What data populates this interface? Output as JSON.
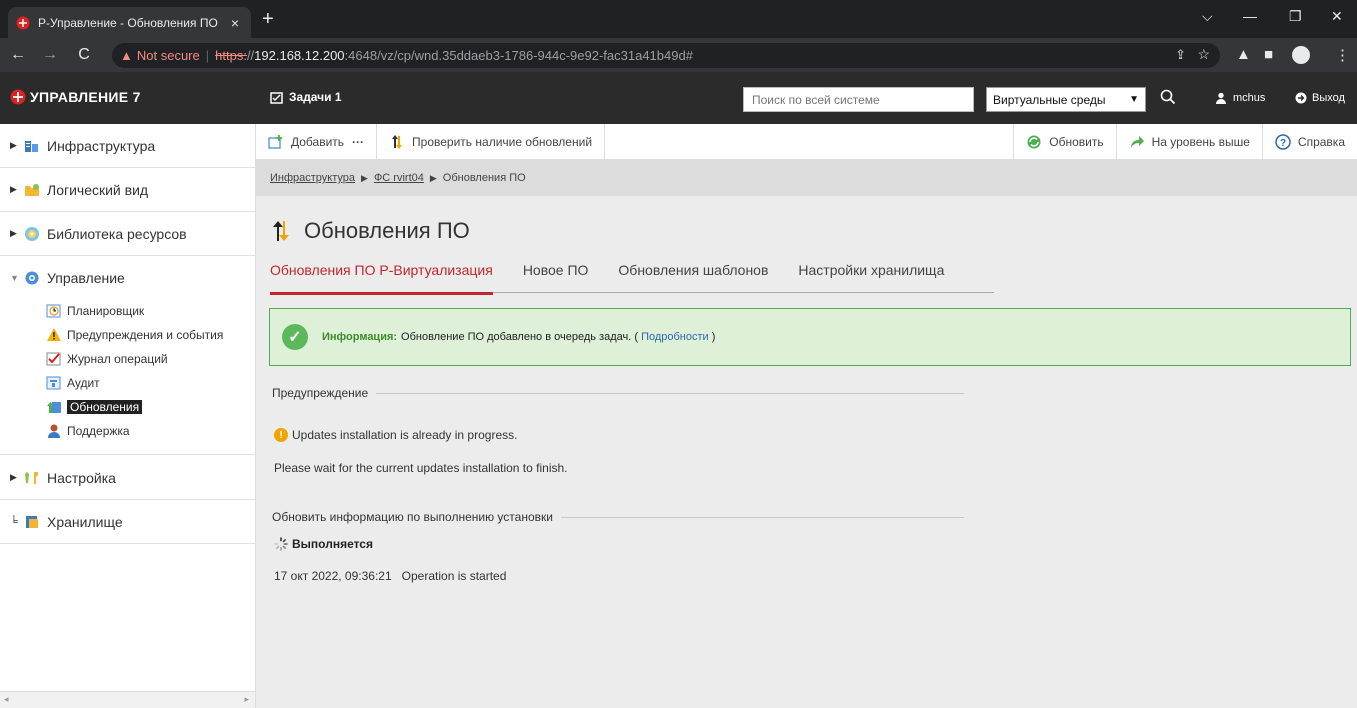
{
  "browser": {
    "tab_title": "Р-Управление - Обновления ПО",
    "tab_close": "×",
    "new_tab": "+",
    "not_secure": "Not secure",
    "url_proto": "https:",
    "url_slashes": "//",
    "url_host": "192.168.12.200",
    "url_path": ":4648/vz/cp/wnd.35ddaeb3-1786-944c-9e92-fac31a41b49d#"
  },
  "header": {
    "logo": "УПРАВЛЕНИЕ 7",
    "tasks_label": "Задачи 1",
    "search_placeholder": "Поиск по всей системе",
    "env_select": "Виртуальные среды",
    "user": "mchus",
    "logout": "Выход"
  },
  "sidebar": {
    "infra": "Инфраструктура",
    "logical": "Логический вид",
    "library": "Библиотека ресурсов",
    "management": "Управление",
    "sub": {
      "scheduler": "Планировщик",
      "alerts": "Предупреждения и события",
      "journal": "Журнал операций",
      "audit": "Аудит",
      "updates": "Обновления",
      "support": "Поддержка"
    },
    "settings": "Настройка",
    "storage": "Хранилище"
  },
  "actions": {
    "add": "Добавить",
    "more": "···",
    "check": "Проверить наличие обновлений",
    "refresh": "Обновить",
    "up": "На уровень выше",
    "help": "Справка"
  },
  "breadcrumb": {
    "root": "Инфраструктура",
    "node": "ФС rvirt04",
    "current": "Обновления ПО"
  },
  "page": {
    "title": "Обновления ПО",
    "tabs": [
      "Обновления ПО Р-Виртуализация",
      "Новое ПО",
      "Обновления шаблонов",
      "Настройки хранилища"
    ],
    "info_label": "Информация:",
    "info_text": "Обновление ПО добавлено в очередь задач. (",
    "info_link": "Подробности",
    "info_close": ")",
    "warning_legend": "Предупреждение",
    "warning_msg": "Updates installation is already in progress.",
    "wait_msg": "Please wait for the current updates installation to finish.",
    "refresh_legend": "Обновить информацию по выполнению установки",
    "running": "Выполняется",
    "log_time": "17 окт 2022, 09:36:21",
    "log_msg": "Operation is started"
  }
}
